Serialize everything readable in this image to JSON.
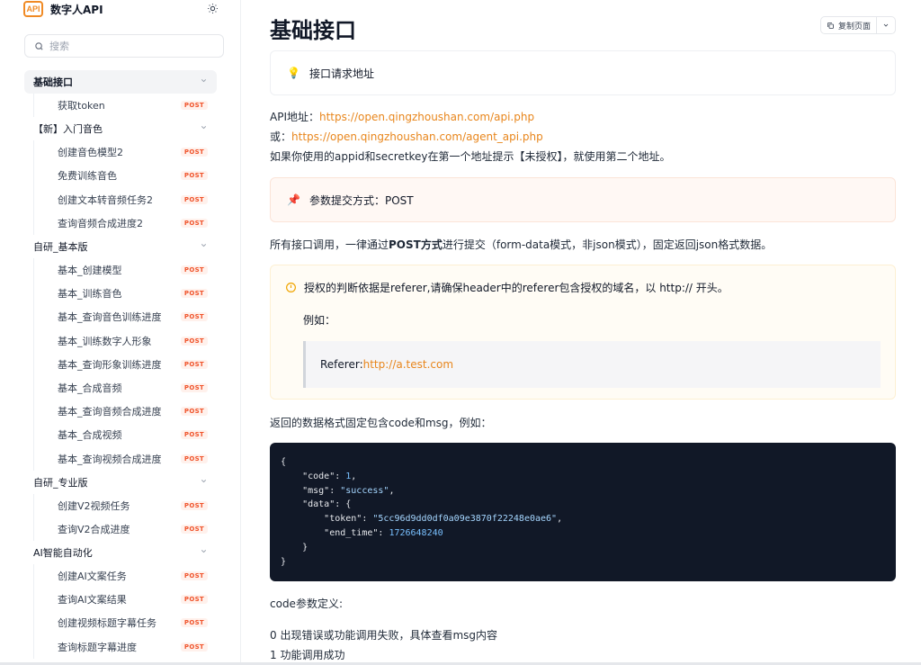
{
  "brand": {
    "logo": "API",
    "name": "数字人API"
  },
  "icons": {
    "theme": "sun-icon",
    "search": "search-icon",
    "copy": "copy-icon",
    "chevron": "chevron-down-icon"
  },
  "search": {
    "placeholder": "搜索"
  },
  "nav": [
    {
      "type": "group",
      "label": "基础接口",
      "active": true
    },
    {
      "type": "item",
      "label": "获取token",
      "badge": "POST"
    },
    {
      "type": "group",
      "label": "【新】入门音色"
    },
    {
      "type": "item",
      "label": "创建音色模型2",
      "badge": "POST"
    },
    {
      "type": "item",
      "label": "免费训练音色",
      "badge": "POST"
    },
    {
      "type": "item",
      "label": "创建文本转音频任务2",
      "badge": "POST"
    },
    {
      "type": "item",
      "label": "查询音频合成进度2",
      "badge": "POST"
    },
    {
      "type": "group",
      "label": "自研_基本版"
    },
    {
      "type": "item",
      "label": "基本_创建模型",
      "badge": "POST"
    },
    {
      "type": "item",
      "label": "基本_训练音色",
      "badge": "POST"
    },
    {
      "type": "item",
      "label": "基本_查询音色训练进度",
      "badge": "POST"
    },
    {
      "type": "item",
      "label": "基本_训练数字人形象",
      "badge": "POST"
    },
    {
      "type": "item",
      "label": "基本_查询形象训练进度",
      "badge": "POST"
    },
    {
      "type": "item",
      "label": "基本_合成音频",
      "badge": "POST"
    },
    {
      "type": "item",
      "label": "基本_查询音频合成进度",
      "badge": "POST"
    },
    {
      "type": "item",
      "label": "基本_合成视频",
      "badge": "POST"
    },
    {
      "type": "item",
      "label": "基本_查询视频合成进度",
      "badge": "POST"
    },
    {
      "type": "group",
      "label": "自研_专业版"
    },
    {
      "type": "item",
      "label": "创建V2视频任务",
      "badge": "POST"
    },
    {
      "type": "item",
      "label": "查询V2合成进度",
      "badge": "POST"
    },
    {
      "type": "group",
      "label": "AI智能自动化"
    },
    {
      "type": "item",
      "label": "创建AI文案任务",
      "badge": "POST"
    },
    {
      "type": "item",
      "label": "查询AI文案结果",
      "badge": "POST"
    },
    {
      "type": "item",
      "label": "创建视频标题字幕任务",
      "badge": "POST"
    },
    {
      "type": "item",
      "label": "查询标题字幕进度",
      "badge": "POST"
    }
  ],
  "main": {
    "title": "基础接口",
    "copy_label": "复制页面",
    "callout1": "接口请求地址",
    "api_label": "API地址：",
    "api_url": "https://open.qingzhoushan.com/api.php",
    "or_label": "或：",
    "agent_url": "https://open.qingzhoushan.com/agent_api.php",
    "note": "如果你使用的appid和secretkey在第一个地址提示【未授权】，就使用第二个地址。",
    "callout2": "参数提交方式：POST",
    "submit_pre": "所有接口调用，一律通过",
    "submit_bold": "POST方式",
    "submit_post": "进行提交（form-data模式，非json模式），固定返回json格式数据。",
    "warn_text": "授权的判断依据是referer,请确保header中的referer包含授权的域名，以 http:// 开头。",
    "example_label": "例如：",
    "referer_label": "Referer: ",
    "referer_url": "http://a.test.com",
    "return_text": "返回的数据格式固定包含code和msg，例如：",
    "code_def_title": "code参数定义:",
    "code0": "0 出现错误或功能调用失败，具体查看msg内容",
    "code1": "1 功能调用成功"
  },
  "code_sample": {
    "code_key": "\"code\"",
    "code_val": "1",
    "msg_key": "\"msg\"",
    "msg_val": "\"success\"",
    "data_key": "\"data\"",
    "token_key": "\"token\"",
    "token_val": "\"5cc96d9dd0df0a09e3870f22248e0ae6\"",
    "end_key": "\"end_time\"",
    "end_val": "1726648240"
  }
}
